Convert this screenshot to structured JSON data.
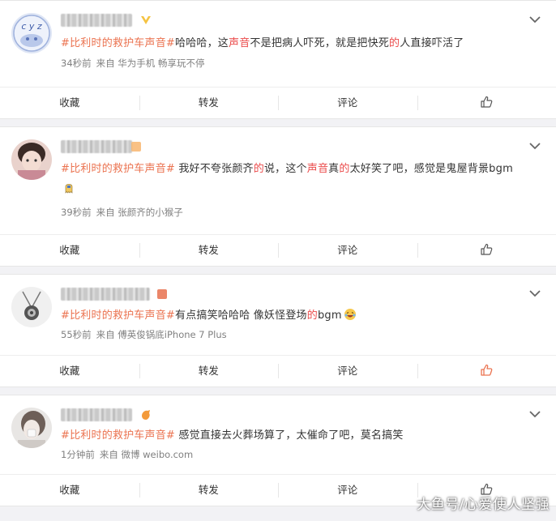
{
  "posts": [
    {
      "hashtag": "#比利时的救护车声音#",
      "segments": [
        {
          "t": "哈哈哈，这"
        },
        {
          "t": "声音",
          "hl": true
        },
        {
          "t": "不是把病人吓死，就是把快死"
        },
        {
          "t": "的",
          "hl": true
        },
        {
          "t": "人直接吓活了"
        }
      ],
      "time": "34秒前",
      "source": "来自 华为手机 畅享玩不停"
    },
    {
      "hashtag": "#比利时的救护车声音#",
      "segments": [
        {
          "t": " 我好不夸张颜齐"
        },
        {
          "t": "的",
          "hl": true
        },
        {
          "t": "说，这个"
        },
        {
          "t": "声音",
          "hl": true
        },
        {
          "t": "真"
        },
        {
          "t": "的",
          "hl": true
        },
        {
          "t": "太好笑了吧，感觉是鬼屋背景bgm"
        }
      ],
      "emoji": "ghost-emoji",
      "time": "39秒前",
      "source": "来自 张颜齐的小猴子"
    },
    {
      "hashtag": "#比利时的救护车声音#",
      "segments": [
        {
          "t": "有点搞笑哈哈哈 像妖怪登场"
        },
        {
          "t": "的",
          "hl": true
        },
        {
          "t": "bgm"
        }
      ],
      "emoji": "laugh-emoji",
      "time": "55秒前",
      "source": "来自 傅英俊锅底iPhone 7 Plus"
    },
    {
      "hashtag": "#比利时的救护车声音#",
      "segments": [
        {
          "t": " 感觉直接去火葬场算了，太催命了吧，莫名搞笑"
        }
      ],
      "time": "1分钟前",
      "source": "来自 微博 weibo.com"
    }
  ],
  "actions": {
    "collect": "收藏",
    "repost": "转发",
    "comment": "评论"
  },
  "colors": {
    "hashtag": "#eb7350",
    "highlight": "#eb4c4c",
    "liked": "#eb7350"
  },
  "watermark": "大鱼号/心爱使人坚强"
}
